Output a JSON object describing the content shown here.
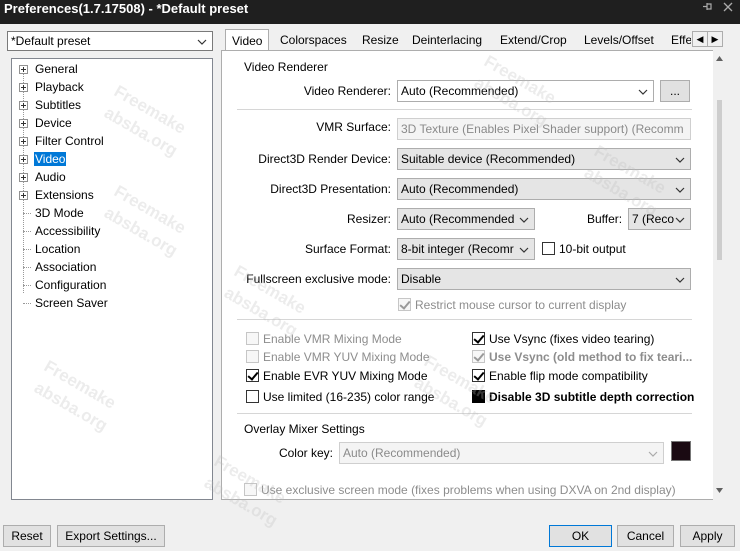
{
  "window": {
    "title": "Preferences(1.7.17508) - *Default preset",
    "pin_icon": "pin-icon",
    "close_icon": "close-icon"
  },
  "preset": {
    "value": "*Default preset"
  },
  "tree": {
    "items": [
      {
        "label": "General",
        "expandable": true
      },
      {
        "label": "Playback",
        "expandable": true
      },
      {
        "label": "Subtitles",
        "expandable": true
      },
      {
        "label": "Device",
        "expandable": true
      },
      {
        "label": "Filter Control",
        "expandable": true
      },
      {
        "label": "Video",
        "expandable": true,
        "selected": true
      },
      {
        "label": "Audio",
        "expandable": true
      },
      {
        "label": "Extensions",
        "expandable": true
      },
      {
        "label": "3D Mode",
        "expandable": false
      },
      {
        "label": "Accessibility",
        "expandable": false
      },
      {
        "label": "Location",
        "expandable": false
      },
      {
        "label": "Association",
        "expandable": false
      },
      {
        "label": "Configuration",
        "expandable": false
      },
      {
        "label": "Screen Saver",
        "expandable": false
      }
    ]
  },
  "tabs": [
    "Video",
    "Colorspaces",
    "Resize",
    "Deinterlacing",
    "Extend/Crop",
    "Levels/Offset",
    "Effe"
  ],
  "active_tab": "Video",
  "video_renderer": {
    "group_title": "Video Renderer",
    "renderer_label": "Video Renderer:",
    "renderer_value": "Auto (Recommended)",
    "more_button": "...",
    "vmr_surface_label": "VMR Surface:",
    "vmr_surface_value": "3D Texture (Enables Pixel Shader support) (Recomm",
    "d3d_device_label": "Direct3D Render Device:",
    "d3d_device_value": "Suitable device (Recommended)",
    "d3d_presentation_label": "Direct3D Presentation:",
    "d3d_presentation_value": "Auto (Recommended)",
    "resizer_label": "Resizer:",
    "resizer_value": "Auto (Recommended",
    "buffer_label": "Buffer:",
    "buffer_value": "7 (Reco",
    "surface_format_label": "Surface Format:",
    "surface_format_value": "8-bit integer (Recomr",
    "ten_bit_label": "10-bit output",
    "fullscreen_label": "Fullscreen exclusive mode:",
    "fullscreen_value": "Disable",
    "restrict_mouse_label": "Restrict mouse cursor to current display"
  },
  "checkboxes": {
    "vmr_mixing": "Enable VMR Mixing Mode",
    "vmr_yuv": "Enable VMR YUV Mixing Mode",
    "evr_yuv": "Enable EVR YUV Mixing Mode",
    "limited_range": "Use limited (16-235) color range",
    "vsync": "Use Vsync (fixes video tearing)",
    "vsync_old": "Use Vsync (old method to fix teari...",
    "flip_mode": "Enable flip mode compatibility",
    "disable_3d_sub": "Disable 3D subtitle depth correction"
  },
  "overlay": {
    "group_title": "Overlay Mixer Settings",
    "color_key_label": "Color key:",
    "color_key_value": "Auto (Recommended)",
    "color_swatch": "#1a0a12",
    "exclusive_label": "Use exclusive screen mode (fixes problems when using DXVA on 2nd display)"
  },
  "buttons": {
    "reset": "Reset",
    "export": "Export Settings...",
    "ok": "OK",
    "cancel": "Cancel",
    "apply": "Apply"
  },
  "watermark": {
    "line1": "Freemake",
    "line2": "absba.org"
  },
  "colors": {
    "accent": "#0078d7",
    "titlebar": "#1f1f1f"
  }
}
